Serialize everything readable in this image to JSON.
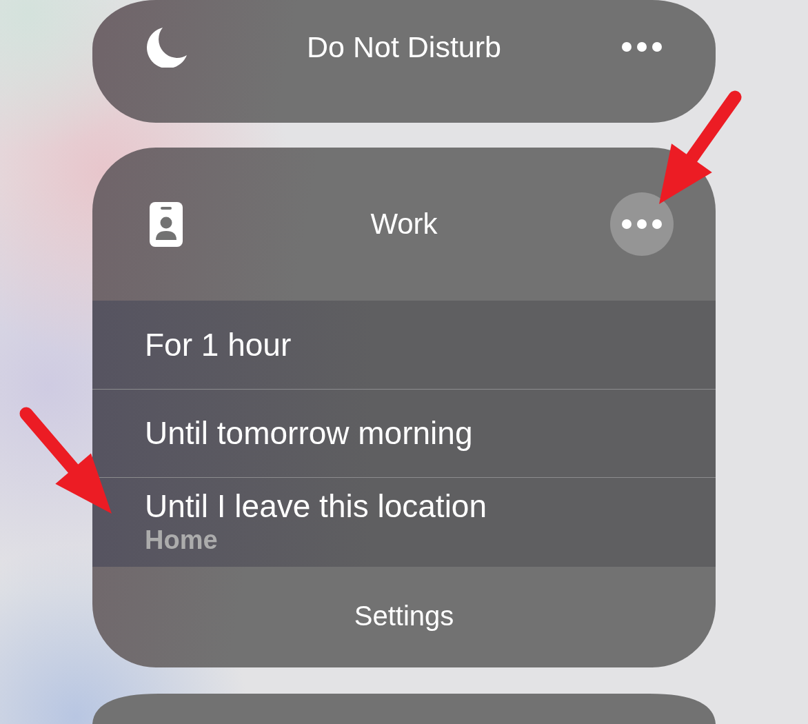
{
  "focus_modes": [
    {
      "title": "Do Not Disturb",
      "expanded": false
    },
    {
      "title": "Work",
      "expanded": true,
      "options": [
        {
          "label": "For 1 hour"
        },
        {
          "label": "Until tomorrow morning"
        },
        {
          "label": "Until I leave this location",
          "detail": "Home"
        }
      ],
      "settings": "Settings"
    }
  ]
}
